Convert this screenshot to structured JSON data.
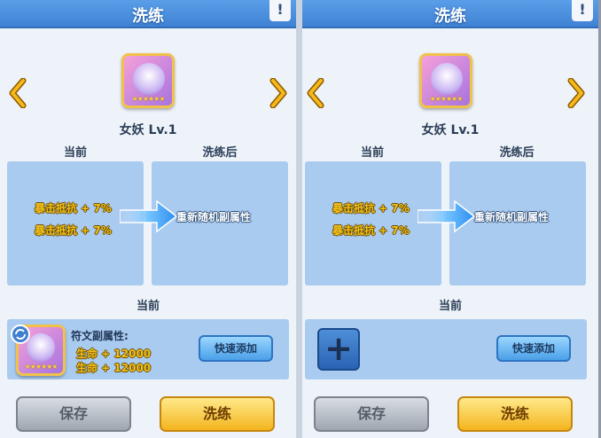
{
  "panels": [
    {
      "title": "洗练",
      "help_icon": "!",
      "rune_name": "女妖 Lv.1",
      "current_header": "当前",
      "after_header": "洗练后",
      "current_attrs": [
        "暴击抵抗 + 7%",
        "暴击抵抗 + 7%"
      ],
      "after_text": "重新随机副属性",
      "current_section_title": "当前",
      "sub_attr_label": "符文副属性:",
      "sub_attrs": [
        "生命 + 12000",
        "生命 + 12000"
      ],
      "quick_add": "快速添加",
      "save": "保存",
      "refine": "洗练",
      "stars": "★★★★★★"
    },
    {
      "title": "洗练",
      "help_icon": "!",
      "rune_name": "女妖 Lv.1",
      "current_header": "当前",
      "after_header": "洗练后",
      "current_attrs": [
        "暴击抵抗 + 7%",
        "暴击抵抗 + 7%"
      ],
      "after_text": "重新随机副属性",
      "current_section_title": "当前",
      "add_slot": "+",
      "quick_add": "快速添加",
      "save": "保存",
      "refine": "洗练",
      "stars": "★★★★★★"
    }
  ],
  "colors": {
    "title_bar": "#4a8fe0",
    "box": "#aacbf0",
    "attr_text": "#f2c21a",
    "refine_button": "#f4b51e",
    "save_button": "#a9b0b8"
  }
}
